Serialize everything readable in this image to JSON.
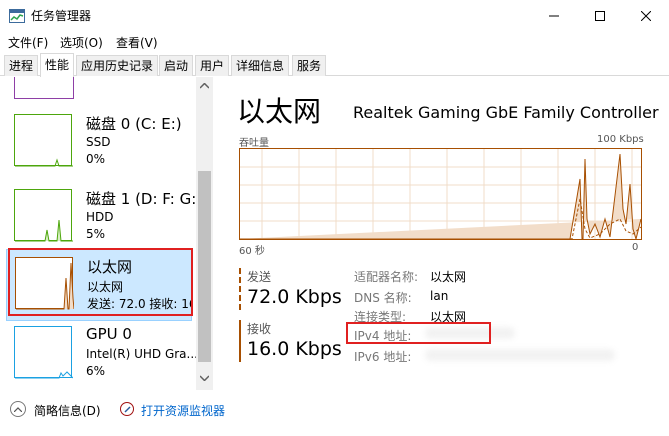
{
  "window": {
    "title": "任务管理器",
    "controls": {
      "minimize": "minimize-icon",
      "maximize": "maximize-icon",
      "close": "close-icon"
    }
  },
  "menu": {
    "file": "文件(F)",
    "options": "选项(O)",
    "view": "查看(V)"
  },
  "tabs": [
    {
      "label": "进程",
      "active": false
    },
    {
      "label": "性能",
      "active": true
    },
    {
      "label": "应用历史记录",
      "active": false
    },
    {
      "label": "启动",
      "active": false
    },
    {
      "label": "用户",
      "active": false
    },
    {
      "label": "详细信息",
      "active": false
    },
    {
      "label": "服务",
      "active": false
    }
  ],
  "resources": [
    {
      "title": "磁盘 0 (C: E:)",
      "line1": "SSD",
      "line2": "0%",
      "color": "#4da60c",
      "selected": false
    },
    {
      "title": "磁盘 1 (D: F: G:",
      "line1": "HDD",
      "line2": "5%",
      "color": "#4da60c",
      "selected": false
    },
    {
      "title": "以太网",
      "line1": "以太网",
      "line2": "发送: 72.0 接收: 16.",
      "color": "#a74f01",
      "selected": true
    },
    {
      "title": "GPU 0",
      "line1": "Intel(R) UHD Gra...",
      "line2": "6%",
      "color": "#1ba1e2",
      "selected": false
    }
  ],
  "ethernet": {
    "title": "以太网",
    "adapter": "Realtek Gaming GbE Family Controller",
    "graph": {
      "label": "吞吐量",
      "max": "100 Kbps",
      "time_span": "60 秒",
      "min": "0",
      "color": "#a74f01"
    },
    "send_label": "发送",
    "send_value": "72.0 Kbps",
    "receive_label": "接收",
    "receive_value": "16.0 Kbps",
    "properties": [
      {
        "label": "适配器名称:",
        "value": "以太网"
      },
      {
        "label": "DNS 名称:",
        "value": "lan"
      },
      {
        "label": "连接类型:",
        "value": "以太网"
      },
      {
        "label": "IPv4 地址:",
        "value": ""
      },
      {
        "label": "IPv6 地址:",
        "value": ""
      }
    ]
  },
  "footer": {
    "brief_info": "简略信息(D)",
    "open_monitor": "打开资源监视器"
  }
}
